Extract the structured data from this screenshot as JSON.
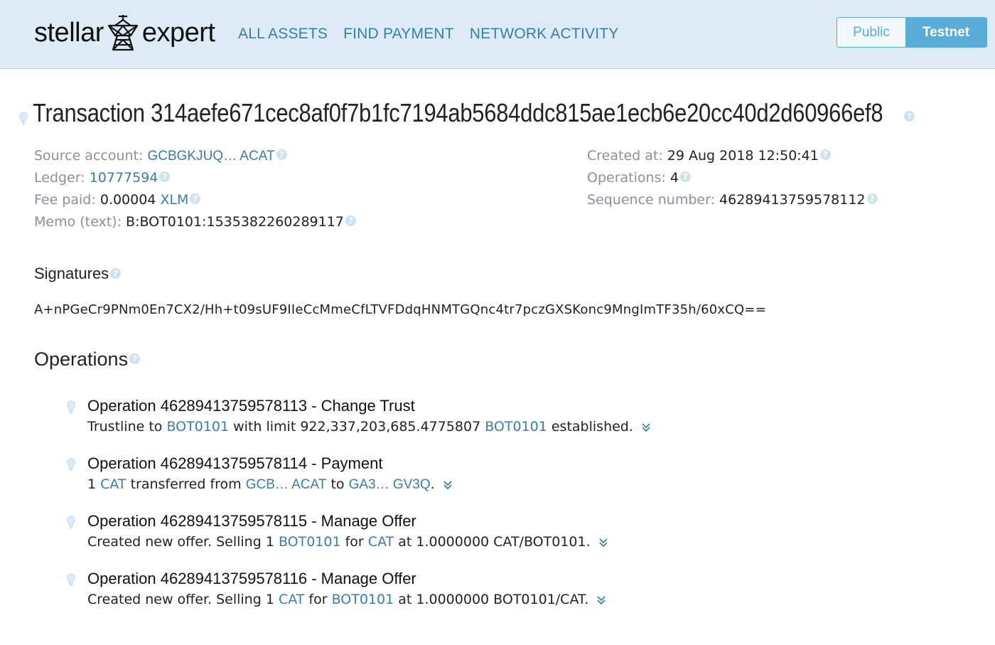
{
  "header": {
    "logo_left": "stellar",
    "logo_right": "expert",
    "nav": [
      "ALL ASSETS",
      "FIND PAYMENT",
      "NETWORK ACTIVITY"
    ],
    "network": {
      "public": "Public",
      "testnet": "Testnet",
      "active": "testnet"
    }
  },
  "transaction": {
    "title": "Transaction 314aefe671cec8af0f7b1fc7194ab5684ddc815ae1ecb6e20cc40d2d60966ef8",
    "source_label": "Source account:",
    "source_value": "GCBGKJUQ… ACAT",
    "ledger_label": "Ledger:",
    "ledger_value": "10777594",
    "fee_label": "Fee paid:",
    "fee_amount": "0.00004",
    "fee_asset": "XLM",
    "memo_label": "Memo (text):",
    "memo_value": "B:BOT0101:1535382260289117",
    "created_label": "Created at:",
    "created_value": "29 Aug 2018 12:50:41",
    "operations_label": "Operations:",
    "operations_value": "4",
    "sequence_label": "Sequence number:",
    "sequence_value": "46289413759578112"
  },
  "signatures": {
    "heading": "Signatures",
    "value": "A+nPGeCr9PNm0En7CX2/Hh+t09sUF9IIeCcMmeCfLTVFDdqHNMTGQnc4tr7pczGXSKonc9MngImTF35h/60xCQ=="
  },
  "operations": {
    "heading": "Operations",
    "items": [
      {
        "title": "Operation 46289413759578113 - Change Trust",
        "desc_1": "Trustline to ",
        "link_1": "BOT0101",
        "desc_2": " with limit 922,337,203,685.4775807 ",
        "link_2": "BOT0101",
        "desc_3": " established."
      },
      {
        "title": "Operation 46289413759578114 - Payment",
        "desc_1": "1 ",
        "link_1": "CAT",
        "desc_2": " transferred from ",
        "link_2": "GCB… ACAT",
        "desc_3": " to ",
        "link_3": "GA3… GV3Q",
        "desc_4": "."
      },
      {
        "title": "Operation 46289413759578115 - Manage Offer",
        "desc_1": "Created new offer. Selling 1 ",
        "link_1": "BOT0101",
        "desc_2": " for ",
        "link_2": "CAT",
        "desc_3": " at 1.0000000 CAT/BOT0101."
      },
      {
        "title": "Operation 46289413759578116 - Manage Offer",
        "desc_1": "Created new offer. Selling 1 ",
        "link_1": "CAT",
        "desc_2": " for ",
        "link_2": "BOT0101",
        "desc_3": " at 1.0000000 BOT0101/CAT."
      }
    ]
  },
  "icons": {
    "help": "question-circle-icon",
    "hint": "lightbulb-icon",
    "expand": "double-chevron-down-icon",
    "logo": "satellite-tower-icon"
  },
  "colors": {
    "header_bg": "#dcebf5",
    "link": "#3a7ea8",
    "accent": "#5aacd8",
    "label": "#8a9098"
  }
}
